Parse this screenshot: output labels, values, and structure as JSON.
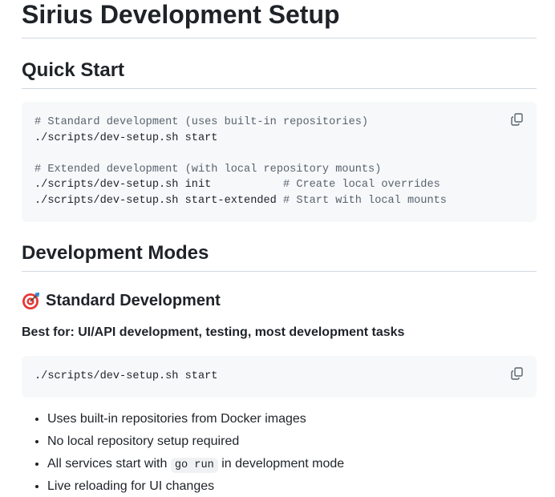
{
  "title": "Sirius Development Setup",
  "quick_start": {
    "heading": "Quick Start",
    "code": {
      "comment1": "# Standard development (uses built-in repositories)",
      "line1": "./scripts/dev-setup.sh start",
      "comment2": "# Extended development (with local repository mounts)",
      "line2_cmd": "./scripts/dev-setup.sh init           ",
      "line2_comment": "# Create local overrides",
      "line3_cmd": "./scripts/dev-setup.sh start-extended ",
      "line3_comment": "# Start with local mounts"
    }
  },
  "modes": {
    "heading": "Development Modes",
    "standard": {
      "icon": "target-icon",
      "heading": "Standard Development",
      "best_for": "Best for: UI/API development, testing, most development tasks",
      "code": "./scripts/dev-setup.sh start",
      "bullets": [
        "Uses built-in repositories from Docker images",
        "No local repository setup required"
      ],
      "bullet3_pre": "All services start with ",
      "bullet3_code": "go run",
      "bullet3_post": " in development mode",
      "bullet4": "Live reloading for UI changes"
    }
  },
  "colors": {
    "code_bg": "#f6f8fa",
    "comment": "#59636e",
    "text": "#1f2328",
    "rule": "#d1d9e0"
  }
}
